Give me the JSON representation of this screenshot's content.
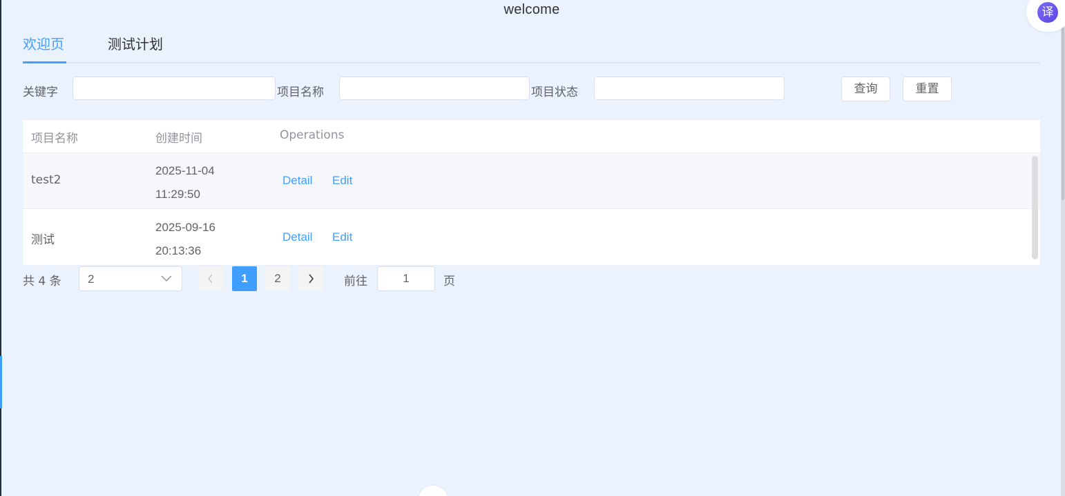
{
  "header": {
    "title": "welcome"
  },
  "translate": {
    "icon": "translate-icon",
    "glyph": "译"
  },
  "tabs": [
    {
      "label": "欢迎页",
      "active": true
    },
    {
      "label": "测试计划",
      "active": false
    }
  ],
  "filters": {
    "keyword_label": "关键字",
    "keyword_value": "",
    "project_name_label": "项目名称",
    "project_name_value": "",
    "project_status_label": "项目状态",
    "project_status_value": "",
    "query_button": "查询",
    "reset_button": "重置"
  },
  "table": {
    "columns": [
      "项目名称",
      "创建时间",
      "Operations"
    ],
    "rows": [
      {
        "name": "test2",
        "created_date": "2025-11-04",
        "created_time": "11:29:50",
        "detail": "Detail",
        "edit": "Edit"
      },
      {
        "name": "测试",
        "created_date": "2025-09-16",
        "created_time": "20:13:36",
        "detail": "Detail",
        "edit": "Edit"
      }
    ]
  },
  "pagination": {
    "total_text": "共 4 条",
    "page_size": "2",
    "pages": [
      "1",
      "2"
    ],
    "current_page": "1",
    "goto_prefix": "前往",
    "goto_value": "1",
    "goto_suffix": "页"
  },
  "colors": {
    "accent": "#409eff",
    "background": "#eaf2fe",
    "text": "#606266"
  }
}
